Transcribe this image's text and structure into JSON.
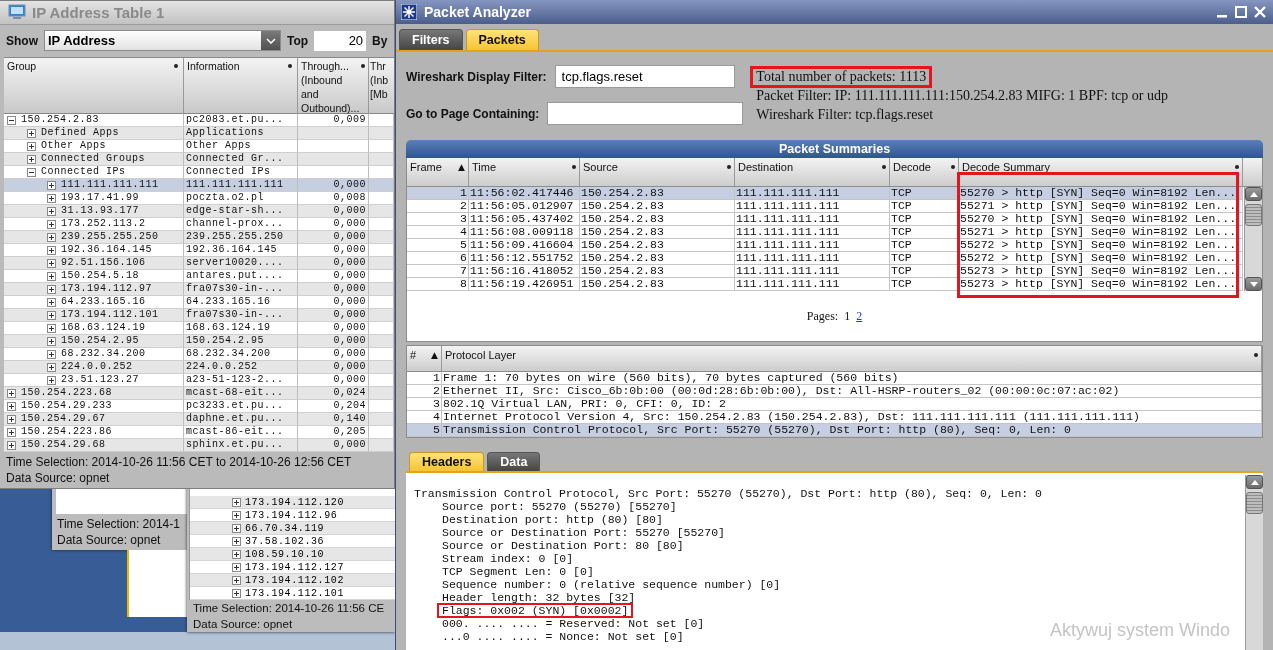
{
  "ip_table_window": {
    "title": "IP Address Table 1",
    "show_label": "Show",
    "show_value": "IP Address",
    "top_label": "Top",
    "top_value": "20",
    "by_label": "By",
    "columns": [
      {
        "label": "Group",
        "has_menu": true
      },
      {
        "label": "Information",
        "has_menu": true
      },
      {
        "label": "Through... (Inbound and Outbound)...",
        "has_menu": true
      },
      {
        "label": "Thr (Inb [Mb",
        "has_menu": false
      }
    ],
    "tree": [
      {
        "group": "150.254.2.83",
        "information": "pc2083.et.pu...",
        "throughput": "0,009",
        "expanded": true,
        "selected": false,
        "children": [
          {
            "group": "Defined Apps",
            "information": "Applications",
            "expanded": false,
            "selected": false
          },
          {
            "group": "Other Apps",
            "information": "Other Apps",
            "expanded": false,
            "selected": false
          },
          {
            "group": "Connected Groups",
            "information": "Connected Gr...",
            "expanded": false,
            "selected": false
          },
          {
            "group": "Connected IPs",
            "information": "Connected IPs",
            "expanded": true,
            "selected": false,
            "children": [
              {
                "group": "111.111.111.111",
                "information": "111.111.111.111",
                "throughput": "0,000",
                "expanded": false,
                "selected": true
              },
              {
                "group": "193.17.41.99",
                "information": "poczta.o2.pl",
                "throughput": "0,008",
                "expanded": false,
                "selected": false
              },
              {
                "group": "31.13.93.177",
                "information": "edge-star-sh...",
                "throughput": "0,000",
                "expanded": false,
                "selected": false
              },
              {
                "group": "173.252.113.2",
                "information": "channel-prox...",
                "throughput": "0,000",
                "expanded": false,
                "selected": false
              },
              {
                "group": "239.255.255.250",
                "information": "239.255.255.250",
                "throughput": "0,000",
                "expanded": false,
                "selected": false
              },
              {
                "group": "192.36.164.145",
                "information": "192.36.164.145",
                "throughput": "0,000",
                "expanded": false,
                "selected": false
              },
              {
                "group": "92.51.156.106",
                "information": "server10020....",
                "throughput": "0,000",
                "expanded": false,
                "selected": false
              },
              {
                "group": "150.254.5.18",
                "information": "antares.put....",
                "throughput": "0,000",
                "expanded": false,
                "selected": false
              },
              {
                "group": "173.194.112.97",
                "information": "fra07s30-in-...",
                "throughput": "0,000",
                "expanded": false,
                "selected": false
              },
              {
                "group": "64.233.165.16",
                "information": "64.233.165.16",
                "throughput": "0,000",
                "expanded": false,
                "selected": false
              },
              {
                "group": "173.194.112.101",
                "information": "fra07s30-in-...",
                "throughput": "0,000",
                "expanded": false,
                "selected": false
              },
              {
                "group": "168.63.124.19",
                "information": "168.63.124.19",
                "throughput": "0,000",
                "expanded": false,
                "selected": false
              },
              {
                "group": "150.254.2.95",
                "information": "150.254.2.95",
                "throughput": "0,000",
                "expanded": false,
                "selected": false
              },
              {
                "group": "68.232.34.200",
                "information": "68.232.34.200",
                "throughput": "0,000",
                "expanded": false,
                "selected": false
              },
              {
                "group": "224.0.0.252",
                "information": "224.0.0.252",
                "throughput": "0,000",
                "expanded": false,
                "selected": false
              },
              {
                "group": "23.51.123.27",
                "information": "a23-51-123-2...",
                "throughput": "0,000",
                "expanded": false,
                "selected": false
              }
            ]
          }
        ]
      },
      {
        "group": "150.254.223.68",
        "information": "mcast-68-eit...",
        "throughput": "0,024",
        "expanded": false,
        "selected": false
      },
      {
        "group": "150.254.29.233",
        "information": "pc3233.et.pu...",
        "throughput": "0,204",
        "expanded": false,
        "selected": false
      },
      {
        "group": "150.254.29.67",
        "information": "daphne.et.pu...",
        "throughput": "0,140",
        "expanded": false,
        "selected": false
      },
      {
        "group": "150.254.223.86",
        "information": "mcast-86-eit...",
        "throughput": "0,205",
        "expanded": false,
        "selected": false
      },
      {
        "group": "150.254.29.68",
        "information": "sphinx.et.pu...",
        "throughput": "0,000",
        "expanded": false,
        "selected": false
      }
    ],
    "footer": [
      "Time Selection: 2014-10-26 11:56 CET to 2014-10-26 12:56 CET",
      "Data Source: opnet"
    ]
  },
  "back_window_left": {
    "footer": [
      "Time Selection: 2014-1",
      "Data Source: opnet"
    ]
  },
  "back_window_middle": {
    "rows": [
      {
        "label": "173.194.112.120",
        "expanded": false
      },
      {
        "label": "173.194.112.96",
        "expanded": false
      },
      {
        "label": "66.70.34.119",
        "expanded": false
      },
      {
        "label": "37.58.102.36",
        "expanded": false
      },
      {
        "label": "108.59.10.10",
        "expanded": false
      },
      {
        "label": "173.194.112.127",
        "expanded": false
      },
      {
        "label": "173.194.112.102",
        "expanded": false
      },
      {
        "label": "173.194.112.101",
        "expanded": false
      }
    ],
    "footer": [
      "Time Selection: 2014-10-26 11:56 CE",
      "Data Source: opnet"
    ]
  },
  "packet_analyzer": {
    "title": "Packet Analyzer",
    "tabs": [
      {
        "label": "Filters",
        "selected": false
      },
      {
        "label": "Packets",
        "selected": true
      }
    ],
    "display_filter": {
      "label": "Wireshark Display Filter:",
      "value": "tcp.flags.reset"
    },
    "page_search": {
      "label": "Go to Page Containing:"
    },
    "info": [
      {
        "text": "Total number of packets: 1113",
        "highlighted": true
      },
      {
        "text": "Packet Filter: IP: 111.111.111.111:150.254.2.83 MIFG: 1 BPF: tcp or udp",
        "highlighted": false
      },
      {
        "text": "Wireshark Filter: tcp.flags.reset",
        "highlighted": false
      }
    ],
    "summaries": {
      "title": "Packet Summaries",
      "columns": [
        {
          "label": "Frame",
          "sort_icon": "▲",
          "has_menu": false,
          "highlighted": false
        },
        {
          "label": "Time",
          "has_menu": true,
          "highlighted": false
        },
        {
          "label": "Source",
          "has_menu": true,
          "highlighted": false
        },
        {
          "label": "Destination",
          "has_menu": true,
          "highlighted": false
        },
        {
          "label": "Decode",
          "has_menu": true,
          "highlighted": false
        },
        {
          "label": "Decode Summary",
          "has_menu": true,
          "highlighted": true
        }
      ],
      "rows": [
        {
          "frame": "1",
          "time": "11:56:02.417446",
          "source": "150.254.2.83",
          "destination": "111.111.111.111",
          "decode": "TCP",
          "summary": "55270 > http [SYN] Seq=0 Win=8192 Len...",
          "selected": true
        },
        {
          "frame": "2",
          "time": "11:56:05.012907",
          "source": "150.254.2.83",
          "destination": "111.111.111.111",
          "decode": "TCP",
          "summary": "55271 > http [SYN] Seq=0 Win=8192 Len...",
          "selected": false
        },
        {
          "frame": "3",
          "time": "11:56:05.437402",
          "source": "150.254.2.83",
          "destination": "111.111.111.111",
          "decode": "TCP",
          "summary": "55270 > http [SYN] Seq=0 Win=8192 Len...",
          "selected": false
        },
        {
          "frame": "4",
          "time": "11:56:08.009118",
          "source": "150.254.2.83",
          "destination": "111.111.111.111",
          "decode": "TCP",
          "summary": "55271 > http [SYN] Seq=0 Win=8192 Len...",
          "selected": false
        },
        {
          "frame": "5",
          "time": "11:56:09.416604",
          "source": "150.254.2.83",
          "destination": "111.111.111.111",
          "decode": "TCP",
          "summary": "55272 > http [SYN] Seq=0 Win=8192 Len...",
          "selected": false
        },
        {
          "frame": "6",
          "time": "11:56:12.551752",
          "source": "150.254.2.83",
          "destination": "111.111.111.111",
          "decode": "TCP",
          "summary": "55272 > http [SYN] Seq=0 Win=8192 Len...",
          "selected": false
        },
        {
          "frame": "7",
          "time": "11:56:16.418052",
          "source": "150.254.2.83",
          "destination": "111.111.111.111",
          "decode": "TCP",
          "summary": "55273 > http [SYN] Seq=0 Win=8192 Len...",
          "selected": false
        },
        {
          "frame": "8",
          "time": "11:56:19.426951",
          "source": "150.254.2.83",
          "destination": "111.111.111.111",
          "decode": "TCP",
          "summary": "55273 > http [SYN] Seq=0 Win=8192 Len...",
          "selected": false
        }
      ],
      "pages_label": "Pages:",
      "pages": [
        {
          "label": "1",
          "current": true
        },
        {
          "label": "2",
          "current": false
        }
      ]
    },
    "protocol_layer": {
      "columns": [
        {
          "label": "#",
          "sort_icon": "▲",
          "has_menu": false
        },
        {
          "label": "Protocol Layer",
          "has_menu": true
        }
      ],
      "rows": [
        {
          "index": "1",
          "text": "Frame 1: 70 bytes on wire (560 bits), 70 bytes captured (560 bits)",
          "selected": false
        },
        {
          "index": "2",
          "text": "Ethernet II, Src: Cisco_6b:0b:00 (00:0d:28:6b:0b:00), Dst: All-HSRP-routers_02 (00:00:0c:07:ac:02)",
          "selected": false
        },
        {
          "index": "3",
          "text": "802.1Q Virtual LAN, PRI: 0, CFI: 0, ID: 2",
          "selected": false
        },
        {
          "index": "4",
          "text": "Internet Protocol Version 4, Src: 150.254.2.83 (150.254.2.83), Dst: 111.111.111.111 (111.111.111.111)",
          "selected": false
        },
        {
          "index": "5",
          "text": "Transmission Control Protocol, Src Port: 55270 (55270), Dst Port: http (80), Seq: 0, Len: 0",
          "selected": true
        }
      ]
    },
    "detail_tabs": [
      {
        "label": "Headers",
        "selected": true
      },
      {
        "label": "Data",
        "selected": false
      }
    ],
    "headers_tree": [
      {
        "text": "Transmission Control Protocol, Src Port: 55270 (55270), Dst Port: http (80), Seq: 0, Len: 0",
        "highlighted": false,
        "children": [
          {
            "text": "Source port: 55270 (55270) [55270]",
            "highlighted": false
          },
          {
            "text": "Destination port: http (80) [80]",
            "highlighted": false
          },
          {
            "text": "Source or Destination Port: 55270 [55270]",
            "highlighted": false
          },
          {
            "text": "Source or Destination Port: 80 [80]",
            "highlighted": false
          },
          {
            "text": "Stream index: 0 [0]",
            "highlighted": false
          },
          {
            "text": "TCP Segment Len: 0 [0]",
            "highlighted": false
          },
          {
            "text": "Sequence number: 0 (relative sequence number) [0]",
            "highlighted": false
          },
          {
            "text": "Header length: 32 bytes [32]",
            "highlighted": false
          },
          {
            "text": "Flags: 0x002 (SYN) [0x0002]",
            "highlighted": true
          },
          {
            "text": "000. .... .... = Reserved: Not set [0]",
            "highlighted": false
          },
          {
            "text": "...0 .... .... = Nonce: Not set [0]",
            "highlighted": false
          }
        ]
      }
    ]
  },
  "os_notice": "Aktywuj system Windo"
}
